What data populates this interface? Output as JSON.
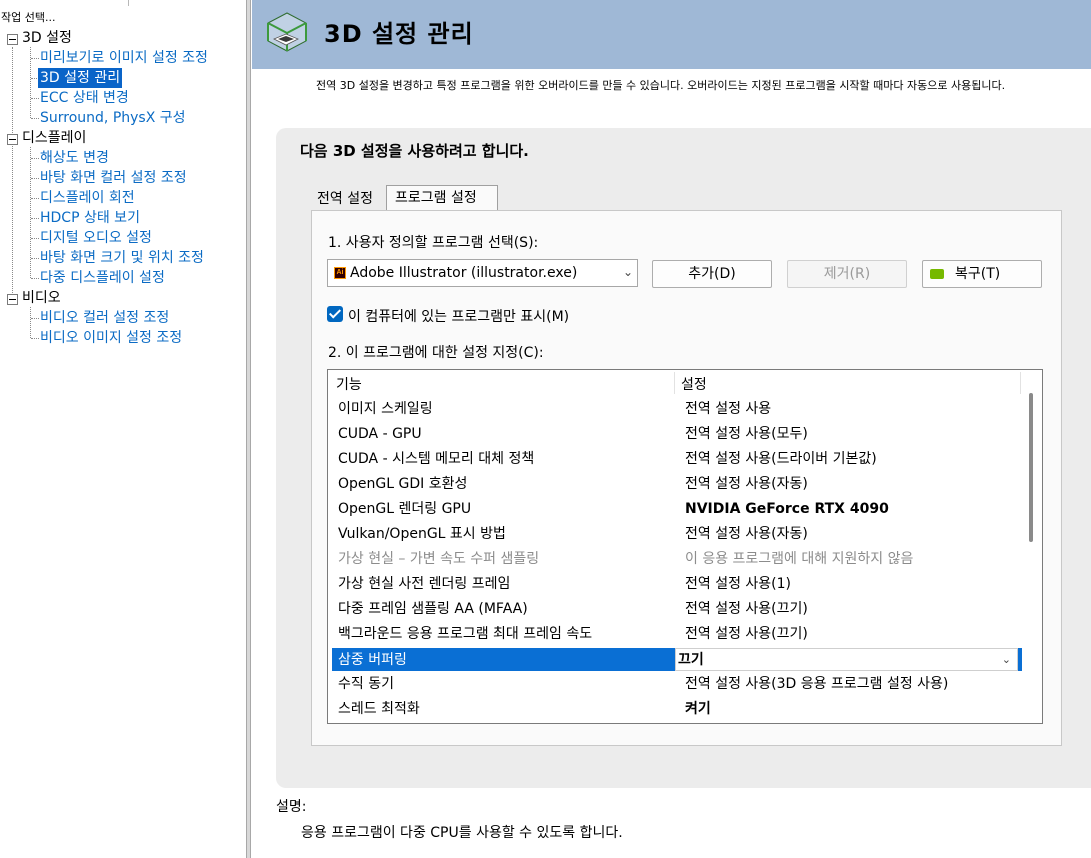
{
  "left_pane": {
    "header": "작업 선택...",
    "tree": [
      {
        "label": "3D 설정",
        "type": "category",
        "items": [
          {
            "label": "미리보기로 이미지 설정 조정"
          },
          {
            "label": "3D 설정 관리",
            "selected": true
          },
          {
            "label": "ECC 상태 변경"
          },
          {
            "label": "Surround, PhysX 구성"
          }
        ]
      },
      {
        "label": "디스플레이",
        "type": "category",
        "items": [
          {
            "label": "해상도 변경"
          },
          {
            "label": "바탕 화면 컬러 설정 조정"
          },
          {
            "label": "디스플레이 회전"
          },
          {
            "label": "HDCP 상태 보기"
          },
          {
            "label": "디지털 오디오 설정"
          },
          {
            "label": "바탕 화면 크기 및 위치 조정"
          },
          {
            "label": "다중 디스플레이 설정"
          }
        ]
      },
      {
        "label": "비디오",
        "type": "category",
        "items": [
          {
            "label": "비디오 컬러 설정 조정"
          },
          {
            "label": "비디오 이미지 설정 조정"
          }
        ]
      }
    ]
  },
  "banner": {
    "title": "3D 설정 관리",
    "icon": "3d-cube-icon"
  },
  "subtitle": "전역 3D 설정을 변경하고 특정 프로그램을 위한 오버라이드를 만들 수 있습니다. 오버라이드는 지정된 프로그램을 시작할 때마다 자동으로 사용됩니다.",
  "panel": {
    "heading": "다음 3D 설정을 사용하려고 합니다.",
    "tabs": [
      {
        "label": "전역 설정",
        "active": false
      },
      {
        "label": "프로그램 설정",
        "active": true
      }
    ],
    "step1_label": "1. 사용자 정의할 프로그램 선택(S):",
    "program_select": {
      "value": "Adobe Illustrator (illustrator.exe)",
      "icon": "adobe-illustrator-icon"
    },
    "buttons": {
      "add": "추가(D)",
      "remove": "제거(R)",
      "restore": "복구(T)"
    },
    "checkbox": {
      "label": "이 컴퓨터에 있는 프로그램만 표시(M)",
      "checked": true
    },
    "step2_label": "2. 이 프로그램에 대한 설정 지정(C):",
    "grid": {
      "headers": [
        "기능",
        "설정"
      ],
      "rows": [
        {
          "feature": "이미지 스케일링",
          "setting": "전역 설정 사용"
        },
        {
          "feature": "CUDA - GPU",
          "setting": "전역 설정 사용(모두)"
        },
        {
          "feature": "CUDA - 시스템 메모리 대체 정책",
          "setting": "전역 설정 사용(드라이버 기본값)"
        },
        {
          "feature": "OpenGL GDI 호환성",
          "setting": "전역 설정 사용(자동)"
        },
        {
          "feature": "OpenGL 렌더링 GPU",
          "setting": "NVIDIA GeForce RTX 4090",
          "bold": true
        },
        {
          "feature": "Vulkan/OpenGL 표시 방법",
          "setting": "전역 설정 사용(자동)"
        },
        {
          "feature": "가상 현실 – 가변 속도 수퍼 샘플링",
          "setting": "이 응용 프로그램에 대해 지원하지 않음",
          "disabled": true
        },
        {
          "feature": "가상 현실 사전 렌더링 프레임",
          "setting": "전역 설정 사용(1)"
        },
        {
          "feature": "다중 프레임 샘플링 AA (MFAA)",
          "setting": "전역 설정 사용(끄기)"
        },
        {
          "feature": "백그라운드 응용 프로그램 최대 프레임 속도",
          "setting": "전역 설정 사용(끄기)"
        },
        {
          "feature": "삼중 버퍼링",
          "setting": "끄기",
          "selected": true
        },
        {
          "feature": "수직 동기",
          "setting": "전역 설정 사용(3D 응용 프로그램 설정 사용)"
        },
        {
          "feature": "스레드 최적화",
          "setting": "켜기",
          "bold": true
        }
      ]
    }
  },
  "description": {
    "label": "설명:",
    "text": "응용 프로그램이 다중 CPU를 사용할 수 있도록 합니다."
  },
  "colors": {
    "banner": "#9fb8d6",
    "selection": "#0a64c8",
    "link": "#0b6bc4",
    "nvidia_green": "#76b900"
  }
}
